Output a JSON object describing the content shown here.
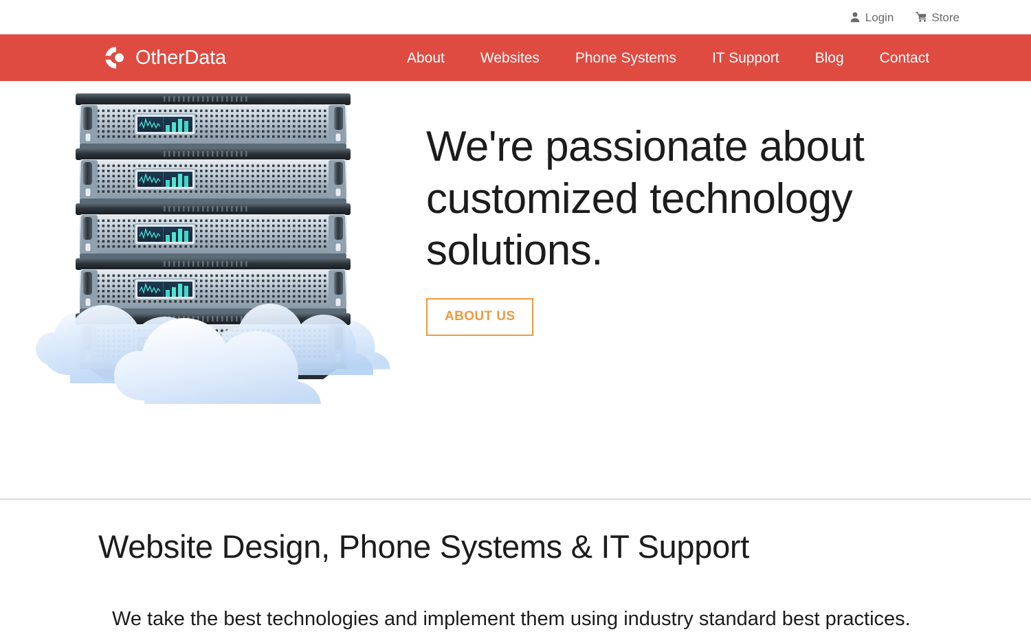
{
  "topbar": {
    "links": [
      {
        "label": "Login",
        "icon": "user-icon"
      },
      {
        "label": "Store",
        "icon": "shopping-cart-icon"
      }
    ]
  },
  "brand": {
    "name": "OtherData",
    "logo_icon": "otherdata-logo-icon",
    "bar_color": "#df4b41",
    "text_color": "#ffffff"
  },
  "nav": {
    "items": [
      {
        "label": "About"
      },
      {
        "label": "Websites"
      },
      {
        "label": "Phone Systems"
      },
      {
        "label": "IT Support"
      },
      {
        "label": "Blog"
      },
      {
        "label": "Contact"
      }
    ]
  },
  "hero": {
    "title": "We're passionate about customized technology solutions.",
    "cta_label": "ABOUT US",
    "cta_color": "#ef9a3d",
    "illustration": "server-stack-with-clouds-illustration"
  },
  "section": {
    "title": "Website Design, Phone Systems & IT Support",
    "subtitle": "We take the best technologies and implement them using industry standard best practices."
  }
}
